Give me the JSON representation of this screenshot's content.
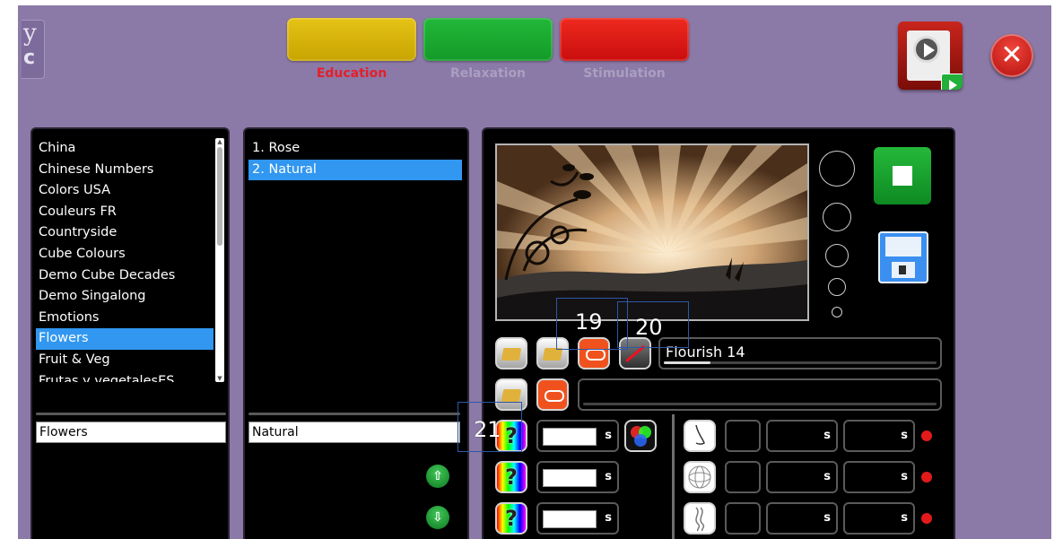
{
  "logo": {
    "line1": "y",
    "line2": "c"
  },
  "modes": {
    "education": "Education",
    "relaxation": "Relaxation",
    "stimulation": "Stimulation",
    "active": "Education"
  },
  "categories": {
    "items": [
      "China",
      "Chinese Numbers",
      "Colors USA",
      "Couleurs FR",
      "Countryside",
      "Cube Colours",
      "Demo Cube Decades",
      "Demo Singalong",
      "Emotions",
      "Flowers",
      "Fruit & Veg",
      "Frutas y vegetalesES"
    ],
    "selected": "Flowers",
    "field_value": "Flowers"
  },
  "theme_items": {
    "items": [
      "1.  Rose",
      "2.  Natural"
    ],
    "selected_index": 1,
    "field_value": "Natural"
  },
  "media": {
    "track_name": "Flourish 14",
    "track_progress": 0.17,
    "second_track_name": "",
    "seconds_unit": "s",
    "sensory_rows": 3
  },
  "annotations": [
    "19",
    "20",
    "21"
  ],
  "icons": {
    "close": "close-x-icon",
    "theatre": "theatre-play-icon",
    "stop": "stop-icon",
    "save": "floppy-disk-icon",
    "folder": "folder-icon",
    "loop": "loop-icon",
    "music_off": "music-off-icon",
    "color_random": "rainbow-question-icon",
    "rgb": "rgb-circles-icon",
    "up": "arrow-up-icon",
    "down": "arrow-down-icon"
  },
  "colors": {
    "background": "#8b79a7",
    "selection": "#3197f0",
    "education": "#d9b800",
    "relaxation": "#1aaa31",
    "stimulation": "#e01515",
    "active_label": "#e4202a"
  }
}
